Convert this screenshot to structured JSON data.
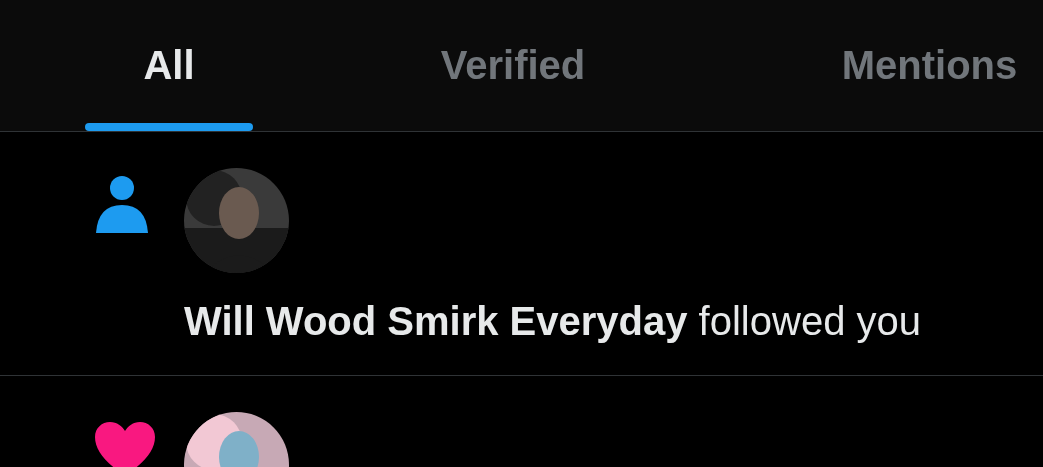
{
  "tabs": [
    {
      "label": "All",
      "selected": true
    },
    {
      "label": "Verified",
      "selected": false
    },
    {
      "label": "Mentions",
      "selected": false
    }
  ],
  "notifications": [
    {
      "kind": "follow",
      "text": "**Will Wood Smirk Everyday** followed you"
    },
    {
      "kind": "like"
    }
  ]
}
